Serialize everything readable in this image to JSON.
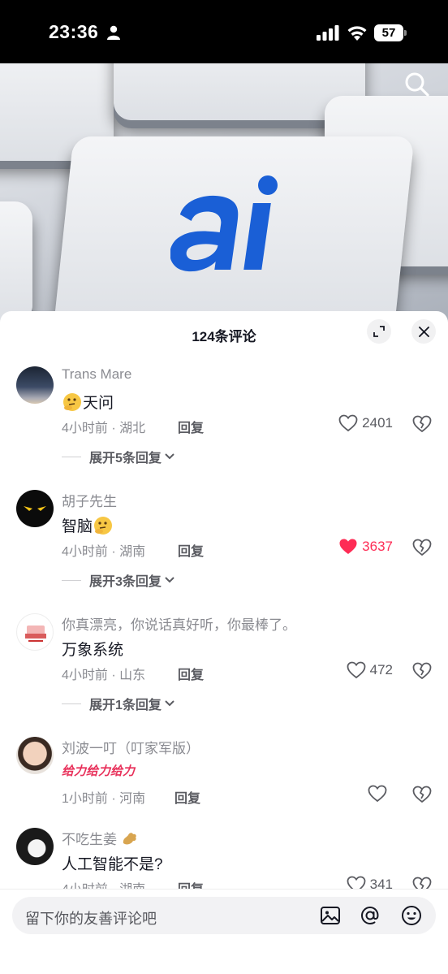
{
  "status_bar": {
    "time": "23:36",
    "battery": "57"
  },
  "panel": {
    "title": "124条评论"
  },
  "comments": [
    {
      "name": "Trans Mare",
      "text": "天问",
      "meta": "4小时前 · 湖北",
      "reply": "回复",
      "likes": "2401",
      "liked": false,
      "expand": "展开5条回复"
    },
    {
      "name": "胡子先生",
      "text": "智脑",
      "meta": "4小时前 · 湖南",
      "reply": "回复",
      "likes": "3637",
      "liked": true,
      "expand": "展开3条回复"
    },
    {
      "name": "你真漂亮，你说话真好听，你最棒了。",
      "text": "万象系统",
      "meta": "4小时前 · 山东",
      "reply": "回复",
      "likes": "472",
      "liked": false,
      "expand": "展开1条回复"
    },
    {
      "name": "刘波一叮（叮家军版）",
      "text": "给力给力给力",
      "meta": "1小时前 · 河南",
      "reply": "回复",
      "likes": "",
      "liked": false
    },
    {
      "name": "不吃生姜",
      "text": "人工智能不是?",
      "meta": "4小时前 · 湖南",
      "reply": "回复",
      "likes": "341",
      "liked": false
    }
  ],
  "input": {
    "placeholder": "留下你的友善评论吧"
  },
  "colors": {
    "like_active": "#fe2c55",
    "text_primary": "#161823",
    "text_secondary": "#8a8b91",
    "brand_blue": "#1a5fd6"
  },
  "icons": [
    "search-icon",
    "fullscreen-icon",
    "close-icon",
    "heart-icon",
    "broken-heart-icon",
    "chevron-down-icon",
    "image-icon",
    "at-icon",
    "emoji-icon"
  ]
}
